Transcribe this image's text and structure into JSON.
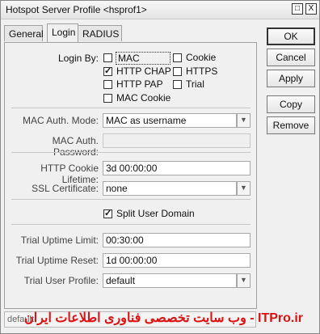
{
  "window": {
    "title": "Hotspot Server Profile <hsprof1>",
    "controls": [
      "□",
      "X"
    ]
  },
  "tabs": [
    "General",
    "Login",
    "RADIUS"
  ],
  "login_by": {
    "label": "Login By:",
    "options": [
      {
        "label": "MAC",
        "checked": false
      },
      {
        "label": "Cookie",
        "checked": false
      },
      {
        "label": "HTTP CHAP",
        "checked": true
      },
      {
        "label": "HTTPS",
        "checked": false
      },
      {
        "label": "HTTP PAP",
        "checked": false
      },
      {
        "label": "Trial",
        "checked": false
      },
      {
        "label": "MAC Cookie",
        "checked": false
      }
    ]
  },
  "fields": {
    "mac_auth_mode": {
      "label": "MAC Auth. Mode:",
      "value": "MAC as username"
    },
    "mac_auth_password": {
      "label": "MAC Auth. Password:",
      "value": ""
    },
    "http_cookie_lifetime": {
      "label": "HTTP Cookie Lifetime:",
      "value": "3d 00:00:00"
    },
    "ssl_certificate": {
      "label": "SSL Certificate:",
      "value": "none"
    },
    "split_user_domain": {
      "label": "Split User Domain",
      "checked": true
    },
    "trial_uptime_limit": {
      "label": "Trial Uptime Limit:",
      "value": "00:30:00"
    },
    "trial_uptime_reset": {
      "label": "Trial Uptime Reset:",
      "value": "1d 00:00:00"
    },
    "trial_user_profile": {
      "label": "Trial User Profile:",
      "value": "default"
    }
  },
  "buttons": [
    "OK",
    "Cancel",
    "Apply",
    "Copy",
    "Remove"
  ],
  "status": {
    "text": "default"
  },
  "watermark": {
    "text": "ITPro.ir - وب سایت تخصصی فناوری اطلاعات ایران",
    "color": "#d11111"
  },
  "colors": {
    "window_bg": "#f0f0f0",
    "field_border": "#a8a8a8"
  }
}
